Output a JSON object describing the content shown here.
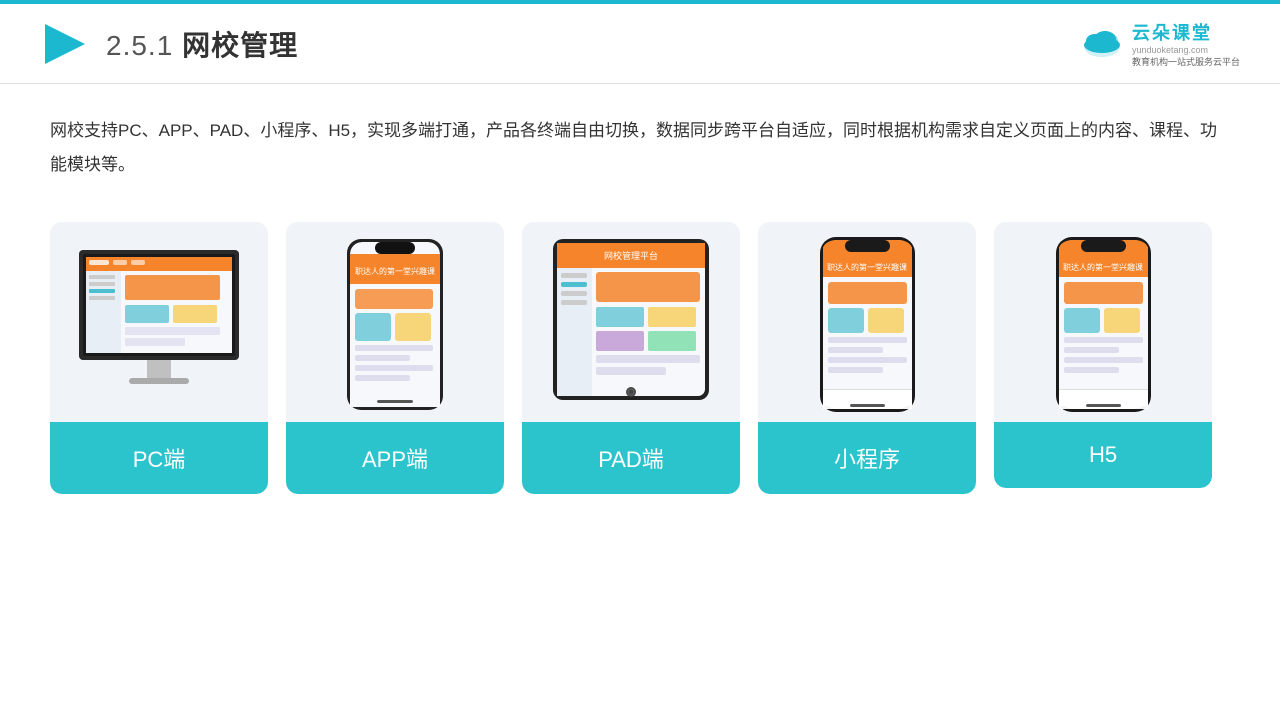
{
  "header": {
    "title_prefix": "2.5.1",
    "title": "网校管理",
    "logo_main": "云朵课堂",
    "logo_sub": "教育机构一站式服务云平台",
    "logo_url": "yunduoketang.com"
  },
  "description": "网校支持PC、APP、PAD、小程序、H5，实现多端打通，产品各终端自由切换，数据同步跨平台自适应，同时根据机构需求自定义页面上的内容、课程、功能模块等。",
  "cards": [
    {
      "label": "PC端",
      "type": "pc"
    },
    {
      "label": "APP端",
      "type": "phone"
    },
    {
      "label": "PAD端",
      "type": "tablet"
    },
    {
      "label": "小程序",
      "type": "phone2"
    },
    {
      "label": "H5",
      "type": "phone3"
    }
  ],
  "accent_color": "#1cb8d0",
  "card_bg_color": "#f0f4f8",
  "card_label_color": "#2cc4cc"
}
